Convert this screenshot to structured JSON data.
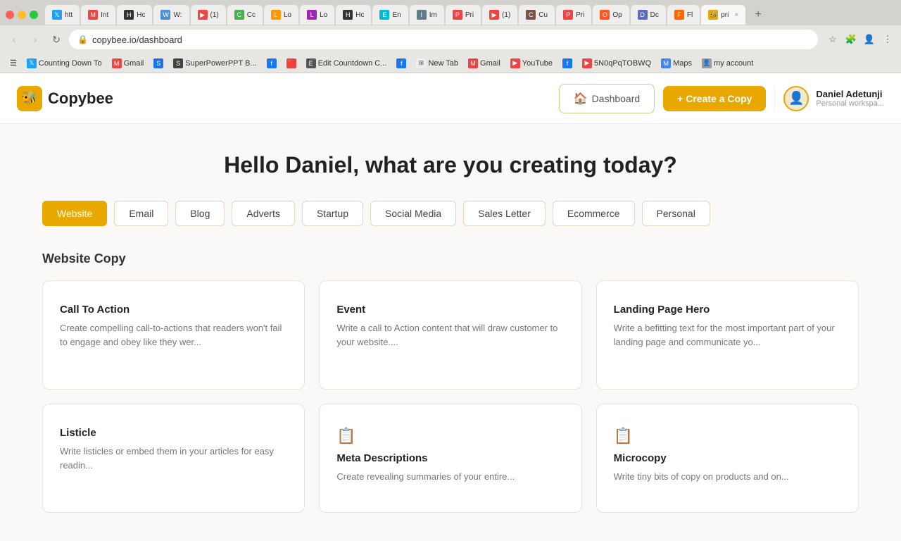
{
  "browser": {
    "address": "copybee.io/dashboard",
    "tabs": [
      {
        "label": "htt",
        "active": false
      },
      {
        "label": "Int",
        "active": false
      },
      {
        "label": "Hc",
        "active": false
      },
      {
        "label": "W:",
        "active": false
      },
      {
        "label": "(1)",
        "active": false
      },
      {
        "label": "Cc",
        "active": false
      },
      {
        "label": "Lo",
        "active": false
      },
      {
        "label": "Lo",
        "active": false
      },
      {
        "label": "Hc",
        "active": false
      },
      {
        "label": "En",
        "active": false
      },
      {
        "label": "Im",
        "active": false
      },
      {
        "label": "Pri",
        "active": false
      },
      {
        "label": "(1)",
        "active": false
      },
      {
        "label": "Cu",
        "active": false
      },
      {
        "label": "Pri",
        "active": false
      },
      {
        "label": "Op",
        "active": false
      },
      {
        "label": "Dc",
        "active": false
      },
      {
        "label": "Fl",
        "active": false
      },
      {
        "label": "pri",
        "active": true
      }
    ],
    "bookmarks": [
      {
        "label": "Counting Down To",
        "color": "#555"
      },
      {
        "label": "Gmail",
        "color": "#e44"
      },
      {
        "label": "SuperPowerPPT B..."
      },
      {
        "label": "Edit Countdown C..."
      },
      {
        "label": "New Tab"
      },
      {
        "label": "Gmail"
      },
      {
        "label": "YouTube",
        "color": "#e44"
      },
      {
        "label": "5N0qPqTOBWQ"
      },
      {
        "label": "Maps"
      },
      {
        "label": "my account"
      }
    ]
  },
  "header": {
    "logo_text": "Copybee",
    "dashboard_label": "Dashboard",
    "create_label": "+ Create a Copy",
    "user_name": "Daniel Adetunji",
    "user_workspace": "Personal workspa..."
  },
  "main": {
    "greeting": "Hello Daniel, what are you creating today?",
    "categories": [
      {
        "label": "Website",
        "active": true
      },
      {
        "label": "Email",
        "active": false
      },
      {
        "label": "Blog",
        "active": false
      },
      {
        "label": "Adverts",
        "active": false
      },
      {
        "label": "Startup",
        "active": false
      },
      {
        "label": "Social Media",
        "active": false
      },
      {
        "label": "Sales Letter",
        "active": false
      },
      {
        "label": "Ecommerce",
        "active": false
      },
      {
        "label": "Personal",
        "active": false
      }
    ],
    "section_title": "Website Copy",
    "cards": [
      {
        "title": "Call To Action",
        "desc": "Create compelling call-to-actions that readers won't fail to engage and obey like they wer...",
        "has_icon": false
      },
      {
        "title": "Event",
        "desc": "Write a call to Action content that will draw customer to your website....",
        "has_icon": false
      },
      {
        "title": "Landing Page Hero",
        "desc": "Write a befitting text for the most important part of your landing page and communicate yo...",
        "has_icon": false
      }
    ],
    "cards_bottom": [
      {
        "title": "Listicle",
        "desc": "Write listicles or embed them in your articles for easy readin...",
        "has_icon": false
      },
      {
        "title": "Meta Descriptions",
        "desc": "Create revealing summaries of your entire...",
        "has_icon": true,
        "icon": "📋"
      },
      {
        "title": "Microcopy",
        "desc": "Write tiny bits of copy on products and on...",
        "has_icon": true,
        "icon": "📋"
      }
    ]
  }
}
